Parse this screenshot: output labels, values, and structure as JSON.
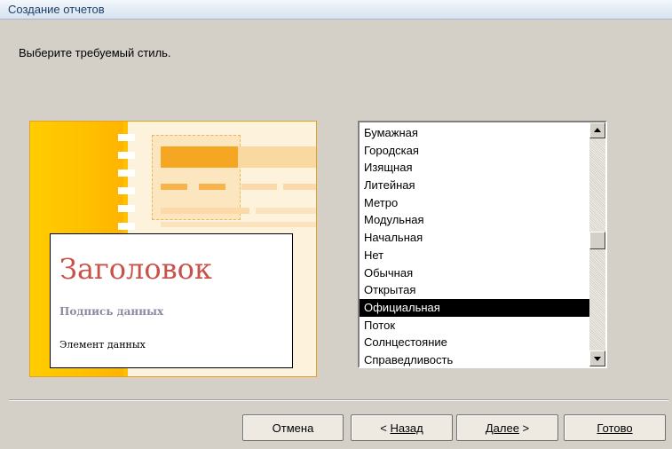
{
  "window": {
    "title": "Создание отчетов"
  },
  "header": {
    "instruction": "Выберите требуемый стиль."
  },
  "preview": {
    "heading": "Заголовок",
    "caption": "Подпись данных",
    "data_item": "Элемент данных",
    "accent_color": "#ffc000"
  },
  "style_list": {
    "items": [
      "Бумажная",
      "Городская",
      "Изящная",
      "Литейная",
      "Метро",
      "Модульная",
      "Начальная",
      "Нет",
      "Обычная",
      "Открытая",
      "Официальная",
      "Поток",
      "Солнцестояние",
      "Справедливость"
    ],
    "selected": "Официальная"
  },
  "buttons": {
    "cancel": "Отмена",
    "back_prefix": "< ",
    "back": "Назад",
    "next": "Далее",
    "next_suffix": " >",
    "finish": "Готово"
  }
}
